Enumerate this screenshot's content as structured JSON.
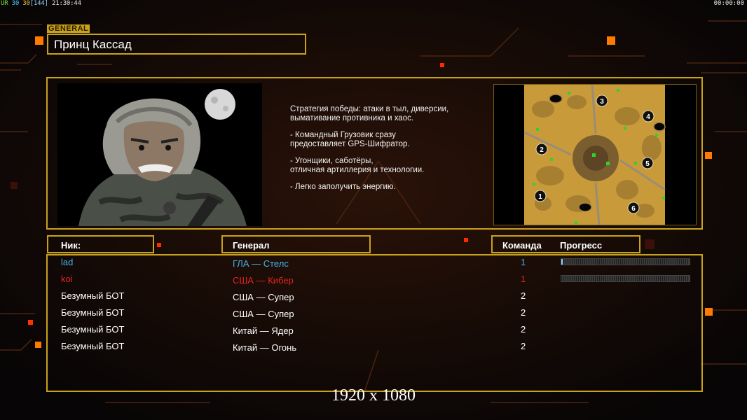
{
  "hud": {
    "fps_prefix": "UR",
    "fps_a": "30",
    "fps_b": "30",
    "fps_c": "[144]",
    "time_left": "21:30:44",
    "time_right": "00:00:00",
    "colors": {
      "prefix": "#7ee03a",
      "fps": "#55c8ff",
      "bracket": "#8fd0ff"
    }
  },
  "general": {
    "tag": "GENERAL",
    "name": "Принц Кассад",
    "strategy": [
      "Стратегия победы: атаки в тыл, диверсии,\n вымативание противника и хаос.",
      "- Командный Грузовик сразу\nпредоставляет GPS-Шифратор.",
      "- Угонщики, саботёры,\nотличная артиллерия и технологии.",
      "- Легко заполучить энергию."
    ]
  },
  "map": {
    "icon": "minimap-icon",
    "start_positions": [
      "1",
      "2",
      "3",
      "4",
      "5",
      "6"
    ]
  },
  "table_headers": {
    "nick": "Ник:",
    "general": "Генерал",
    "team": "Команда",
    "progress": "Прогресс"
  },
  "players": [
    {
      "nick": "lad",
      "general": "ГЛА — Стелс",
      "team": "1",
      "color": "#3fb6e8",
      "progress": 0.01
    },
    {
      "nick": "koi",
      "general": "США — Кибер",
      "team": "1",
      "color": "#e52424",
      "progress": 0.0
    },
    {
      "nick": "Безумный БОТ",
      "general": "США — Супер",
      "team": "2",
      "color": "#ffffff",
      "progress": null
    },
    {
      "nick": "Безумный БОТ",
      "general": "США — Супер",
      "team": "2",
      "color": "#ffffff",
      "progress": null
    },
    {
      "nick": "Безумный БОТ",
      "general": "Китай — Ядер",
      "team": "2",
      "color": "#ffffff",
      "progress": null
    },
    {
      "nick": "Безумный БОТ",
      "general": "Китай — Огонь",
      "team": "2",
      "color": "#ffffff",
      "progress": null
    }
  ],
  "resolution_label": "1920 x 1080",
  "theme": {
    "gold": "#c9a21c",
    "accent_orange": "#ff7a00",
    "background": "#0c0808"
  }
}
